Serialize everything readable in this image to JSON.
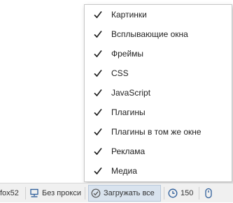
{
  "menu": {
    "items": [
      {
        "label": "Картинки",
        "checked": true
      },
      {
        "label": "Всплывающие окна",
        "checked": true
      },
      {
        "label": "Фреймы",
        "checked": true
      },
      {
        "label": "CSS",
        "checked": true
      },
      {
        "label": "JavaScript",
        "checked": true
      },
      {
        "label": "Плагины",
        "checked": true
      },
      {
        "label": "Плагины в том же окне",
        "checked": true
      },
      {
        "label": "Реклама",
        "checked": true
      },
      {
        "label": "Медиа",
        "checked": true
      }
    ]
  },
  "statusbar": {
    "profile_text": "fox52",
    "proxy_label": "Без прокси",
    "load_all_label": "Загружать все",
    "timeout_value": "150",
    "icons": {
      "proxy": "network-computer-icon",
      "load_all": "check-circle-icon",
      "timeout": "clock-icon",
      "mouse": "mouse-icon"
    }
  },
  "colors": {
    "check": "#1a1a1a",
    "statusbar_bg": "#f0f0f0",
    "pressed_bg": "#d9e3ee",
    "icon_blue": "#2d5d9a"
  }
}
